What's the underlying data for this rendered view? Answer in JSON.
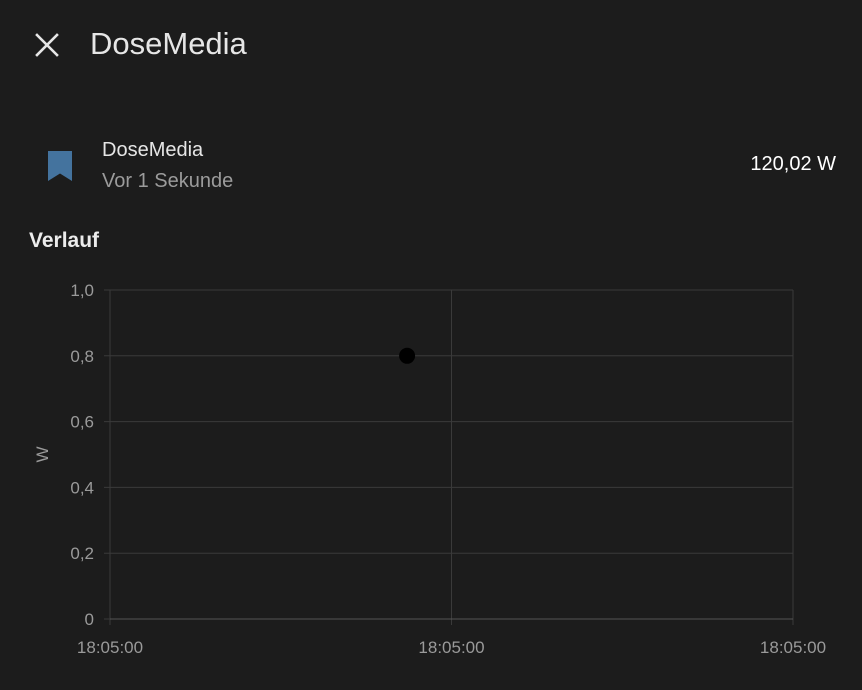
{
  "dialog": {
    "title": "DoseMedia",
    "close_icon": "close-icon"
  },
  "entity": {
    "name": "DoseMedia",
    "last_changed": "Vor 1 Sekunde",
    "state": "120,02 W",
    "icon": "bookmark-icon",
    "icon_color": "#44739e"
  },
  "history": {
    "title": "Verlauf"
  },
  "chart_data": {
    "type": "scatter",
    "ylabel": "W",
    "xlabel": "",
    "title": "",
    "ylim": [
      0,
      1.0
    ],
    "y_ticks": [
      "0",
      "0,2",
      "0,4",
      "0,6",
      "0,8",
      "1,0"
    ],
    "x_ticks": [
      "18:05:00",
      "18:05:00",
      "18:05:00"
    ],
    "grid": true,
    "points": [
      {
        "x": 0.435,
        "y": 0.8
      }
    ],
    "point_color": "#000000"
  }
}
